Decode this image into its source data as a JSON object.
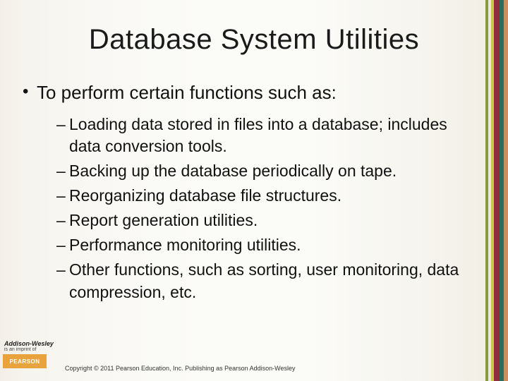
{
  "title": "Database System Utilities",
  "bullets": {
    "main": "To perform certain functions such as:",
    "subs": [
      "Loading data stored in files into a database; includes data conversion tools.",
      "Backing up the database periodically on tape.",
      "Reorganizing database file structures.",
      "Report generation utilities.",
      "Performance monitoring utilities.",
      "Other functions, such as sorting, user monitoring, data compression, etc."
    ]
  },
  "branding": {
    "aw_line1": "Addison-Wesley",
    "aw_line2": "is an imprint of",
    "pearson": "PEARSON"
  },
  "copyright": "Copyright © 2011 Pearson Education, Inc. Publishing as Pearson Addison-Wesley",
  "stripes": [
    {
      "color": "#8a9a3f",
      "w": 4
    },
    {
      "color": "#efe7d6",
      "w": 4
    },
    {
      "color": "#c7c94e",
      "w": 4
    },
    {
      "color": "#8e2f3e",
      "w": 8
    },
    {
      "color": "#2a6e60",
      "w": 6
    },
    {
      "color": "#c8905a",
      "w": 6
    }
  ]
}
